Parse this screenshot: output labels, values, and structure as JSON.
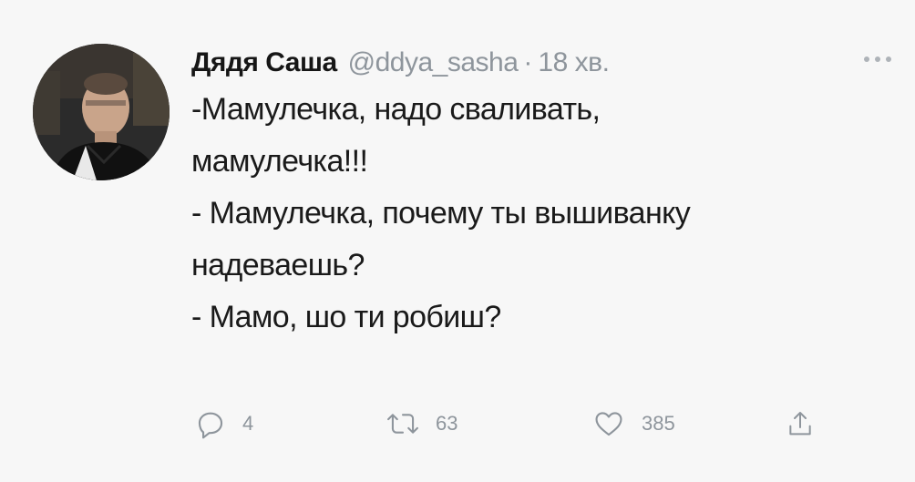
{
  "tweet": {
    "author": {
      "name": "Дядя Саша",
      "handle": "@ddya_sasha",
      "separator": "·",
      "time": "18 хв."
    },
    "lines": [
      "-Мамулечка, надо сваливать,",
      "мамулечка!!!",
      "- Мамулечка, почему ты вышиванку",
      "надеваешь?",
      "- Мамо, шо ти робиш?"
    ],
    "actions": {
      "reply_count": "4",
      "retweet_count": "63",
      "like_count": "385"
    },
    "icons": {
      "reply": "reply-icon",
      "retweet": "retweet-icon",
      "like": "heart-icon",
      "share": "share-icon",
      "more": "more-icon"
    },
    "colors": {
      "background": "#f7f7f7",
      "text": "#1a1a1a",
      "muted": "#8e959c"
    }
  }
}
